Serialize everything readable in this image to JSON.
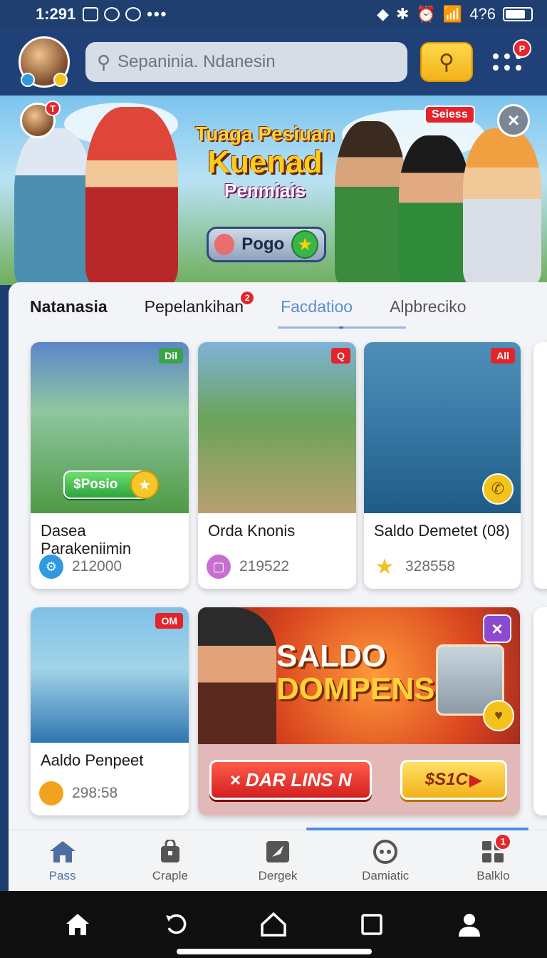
{
  "status_bar": {
    "time": "1:291",
    "battery": "4?6"
  },
  "header": {
    "search_placeholder": "Sepaninia. Ndanesin",
    "menu_badge": "P"
  },
  "banner": {
    "title_line1": "Tuaga Pesiuan",
    "title_line2": "Kuenad",
    "title_line3": "Penmiais",
    "play_label": "Pogo",
    "tag": "Seiess",
    "avatar_badge": "T"
  },
  "tabs": [
    {
      "label": "Natanasia"
    },
    {
      "label": "Pepelankihan",
      "badge": "2"
    },
    {
      "label": "Facdatioo"
    },
    {
      "label": "Alpbreciko"
    }
  ],
  "cards": [
    {
      "title": "Dasea Parakeniimin",
      "value": "212000",
      "tag": "Dil",
      "tag_color": "#3aa34a",
      "button": "$Posio",
      "coin_color": "#2f9ae0"
    },
    {
      "title": "Orda Knonis",
      "value": "219522",
      "tag": "Q",
      "tag_color": "#e3242b",
      "coin_color": "#c76fd0"
    },
    {
      "title": "Saldo Demetet (08)",
      "value": "328558",
      "tag": "All",
      "tag_color": "#e3242b",
      "coin_color": "#f3c21d"
    },
    {
      "title": "Aaldo Penpeet",
      "value": "298:58",
      "tag": "OM",
      "tag_color": "#e3242b",
      "coin_color": "#f3a21d"
    }
  ],
  "promo": {
    "heading_line1": "SALDO",
    "heading_line2": "DOMPENS",
    "btn_primary": "× DAR LINS N",
    "btn_secondary": "$S1C"
  },
  "bottom_nav": [
    {
      "label": "Pass",
      "icon": "home-icon"
    },
    {
      "label": "Craple",
      "icon": "bag-icon"
    },
    {
      "label": "Dergek",
      "icon": "compass-icon"
    },
    {
      "label": "Damiatic",
      "icon": "chat-icon"
    },
    {
      "label": "Balklo",
      "icon": "grid-icon",
      "badge": "1"
    }
  ],
  "colors": {
    "accent": "#4a8fe0",
    "header": "#1f4178",
    "gold": "#f2b21a"
  }
}
